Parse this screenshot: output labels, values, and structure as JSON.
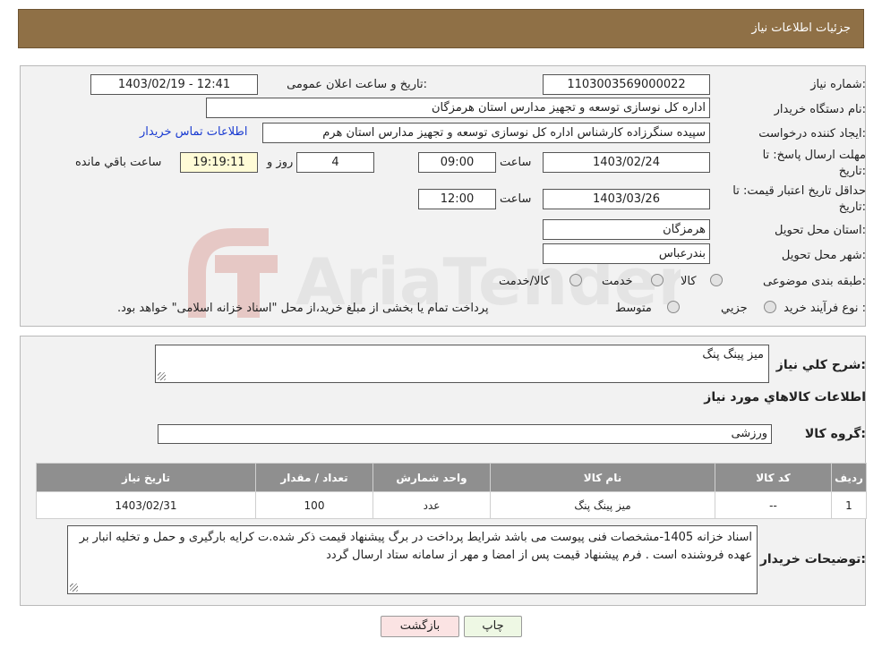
{
  "header": {
    "title": "جزئیات اطلاعات نیاز"
  },
  "watermark": {
    "text": "AriaTender.neT"
  },
  "form": {
    "need_number_label": "شماره نیاز:",
    "need_number": "1103003569000022",
    "announce_label": "تاریخ و ساعت اعلان عمومی:",
    "announce_value": "1403/02/19 - 12:41",
    "buyer_org_label": "نام دستگاه خریدار:",
    "buyer_org": "اداره کل نوسازی  توسعه و تجهیز مدارس استان هرمزگان",
    "requester_label": "ایجاد کننده درخواست:",
    "requester": "سپیده سنگرزاده کارشناس اداره کل نوسازی  توسعه و تجهیز مدارس استان هرم",
    "contact_link": "اطلاعات تماس خریدار",
    "deadline_label_1": "مهلت ارسال پاسخ: تا",
    "deadline_label_2": "تاریخ:",
    "deadline_date": "1403/02/24",
    "time_label": "ساعت",
    "deadline_time": "09:00",
    "days_value": "4",
    "days_label": "روز و",
    "remaining_time": "19:19:11",
    "remaining_label": "ساعت باقي مانده",
    "validity_label_1": "حداقل تاریخ اعتبار قیمت: تا",
    "validity_label_2": "تاریخ:",
    "validity_date": "1403/03/26",
    "validity_time": "12:00",
    "province_label": "استان محل تحویل:",
    "province": "هرمزگان",
    "city_label": "شهر محل تحویل:",
    "city": "بندرعباس",
    "category_label": "طبقه بندی موضوعی:",
    "category_options": [
      "کالا",
      "خدمت",
      "کالا/خدمت"
    ],
    "process_label": "نوع فرآیند خرید :",
    "process_options": [
      "جزیي",
      "متوسط"
    ],
    "process_note": "پرداخت تمام یا بخشی از مبلغ خرید،از محل \"اسناد خزانه اسلامی\" خواهد بود."
  },
  "summary": {
    "desc_label": "شرح كلي نياز:",
    "desc_value": "میز پینگ پنگ",
    "goods_info_title": "اطلاعات کالاهاي مورد نياز",
    "group_label": "گروه کالا:",
    "group_value": "ورزشی"
  },
  "table": {
    "headers": [
      "رديف",
      "کد کالا",
      "نام کالا",
      "واحد شمارش",
      "تعداد / مقدار",
      "تاریخ نیاز"
    ],
    "rows": [
      [
        "1",
        "--",
        "میز پینگ پنگ",
        "عدد",
        "100",
        "1403/02/31"
      ]
    ]
  },
  "notes": {
    "label": "توضیحات خریدار:",
    "text": "اسناد خزانه 1405-مشخصات فنی پیوست می باشد شرایط پرداخت در برگ پیشنهاد قیمت ذکر شده.ت کرایه بارگیری و حمل و تخلیه انبار بر عهده فروشنده است . فرم پیشنهاد قیمت پس از امضا و مهر از سامانه ستاد ارسال گردد"
  },
  "buttons": {
    "print": "چاپ",
    "back": "بازگشت"
  },
  "colors": {
    "header": "#8f7046",
    "table_header": "#8f8f8f",
    "link": "#1a3bd1",
    "back_button": "#fbe3e3"
  }
}
